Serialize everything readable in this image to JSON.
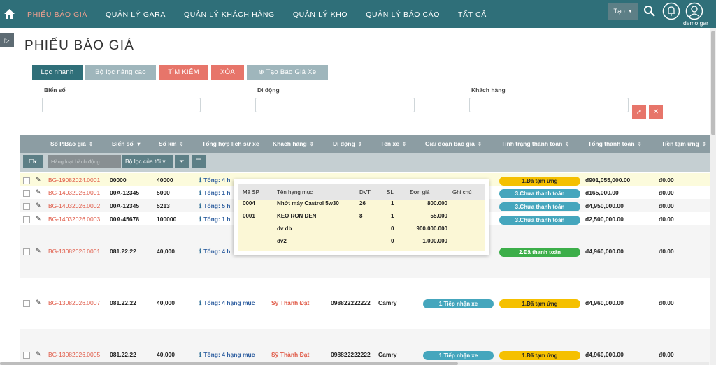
{
  "nav": {
    "items": [
      {
        "label": "PHIẾU BÁO GIÁ",
        "active": true
      },
      {
        "label": "QUẢN LÝ GARA",
        "active": false
      },
      {
        "label": "QUẢN LÝ KHÁCH HÀNG",
        "active": false
      },
      {
        "label": "QUẢN LÝ KHO",
        "active": false
      },
      {
        "label": "QUẢN LÝ BÁO CÁO",
        "active": false
      },
      {
        "label": "TẤT CẢ",
        "active": false
      }
    ],
    "tao_label": "Tạo",
    "user_name": "demo.gar"
  },
  "page_title": "PHIẾU BÁO GIÁ",
  "filter_tabs": {
    "loc_nhanh": "Lọc nhanh",
    "bo_loc_nang_cao": "Bộ lọc nâng cao",
    "tim_kiem": "TÌM KIẾM",
    "xoa": "XÓA",
    "tao_bao_gia": "Tạo Báo Giá Xe"
  },
  "filters": {
    "bien_so": "Biển số",
    "di_dong": "Di động",
    "khach_hang": "Khách hàng"
  },
  "columns": [
    "Số P.Báo giá",
    "Biển số",
    "Số km",
    "Tổng hợp lịch sử xe",
    "Khách hàng",
    "Di động",
    "Tên xe",
    "Giai đoạn báo giá",
    "Tình trạng thanh toán",
    "Tổng thanh toán",
    "Tiền tạm ứng"
  ],
  "toolbar": {
    "bulk_placeholder": "Hàng loạt hành động",
    "my_filter": "Bộ lọc của tôi"
  },
  "rows": [
    {
      "code": "BG-19082024.0001",
      "plate": "00000",
      "km": "40000",
      "history": "Tổng: 4 h",
      "customer": "",
      "phone": "",
      "car": "",
      "stage": "",
      "payment": "1.Đã tạm ứng",
      "payment_color": "yellow",
      "total": "đ901,055,000.00",
      "advance": "đ0.00"
    },
    {
      "code": "BG-14032026.0001",
      "plate": "00A-12345",
      "km": "5000",
      "history": "Tổng: 1 h",
      "customer": "",
      "phone": "",
      "car": "",
      "stage": "",
      "payment": "3.Chưa thanh toán",
      "payment_color": "teal",
      "total": "đ165,000.00",
      "advance": "đ0.00"
    },
    {
      "code": "BG-14032026.0002",
      "plate": "00A-12345",
      "km": "5213",
      "history": "Tổng: 5 h",
      "customer": "",
      "phone": "",
      "car": "",
      "stage": "",
      "payment": "3.Chưa thanh toán",
      "payment_color": "teal",
      "total": "đ4,950,000.00",
      "advance": "đ0.00"
    },
    {
      "code": "BG-14032026.0003",
      "plate": "00A-45678",
      "km": "100000",
      "history": "Tổng: 1 h",
      "customer": "",
      "phone": "",
      "car": "",
      "stage": "",
      "payment": "3.Chưa thanh toán",
      "payment_color": "teal",
      "total": "đ2,500,000.00",
      "advance": "đ0.00"
    },
    {
      "code": "BG-13082026.0001",
      "plate": "081.22.22",
      "km": "40,000",
      "history": "Tổng: 4 h",
      "customer": "",
      "phone": "",
      "car": "",
      "stage": "",
      "payment": "2.Đã thanh toán",
      "payment_color": "green",
      "total": "đ4,960,000.00",
      "advance": "đ0.00"
    },
    {
      "code": "BG-13082026.0007",
      "plate": "081.22.22",
      "km": "40,000",
      "history": "Tổng: 4 hạng mục",
      "customer": "Sỹ Thành Đạt",
      "phone": "098822222222",
      "car": "Camry",
      "stage": "1.Tiếp nhận xe",
      "payment": "1.Đã tạm ứng",
      "payment_color": "yellow",
      "total": "đ4,960,000.00",
      "advance": "đ0.00"
    },
    {
      "code": "BG-13082026.0005",
      "plate": "081.22.22",
      "km": "40,000",
      "history": "Tổng: 4 hạng mục",
      "customer": "Sỹ Thành Đạt",
      "phone": "098822222222",
      "car": "Camry",
      "stage": "1.Tiếp nhận xe",
      "payment": "1.Đã tạm ứng",
      "payment_color": "yellow",
      "total": "đ4,960,000.00",
      "advance": "đ0.00"
    }
  ],
  "popup": {
    "headers": [
      "Mã SP",
      "Tên hạng mục",
      "DVT",
      "SL",
      "Đơn giá",
      "Ghi chú"
    ],
    "items": [
      {
        "ma": "0004",
        "ten": "Nhớt máy Castrol 5w30",
        "dvt": "26",
        "sl": "1",
        "gia": "800.000",
        "ghichu": ""
      },
      {
        "ma": "0001",
        "ten": "KEO RON DEN",
        "dvt": "8",
        "sl": "1",
        "gia": "55.000",
        "ghichu": ""
      },
      {
        "ma": "",
        "ten": "dv db",
        "dvt": "",
        "sl": "0",
        "gia": "900.000.000",
        "ghichu": ""
      },
      {
        "ma": "",
        "ten": "dv2",
        "dvt": "",
        "sl": "0",
        "gia": "1.000.000",
        "ghichu": ""
      }
    ]
  },
  "colors": {
    "nav_bg": "#2f6f79",
    "accent": "#e7756a",
    "active_nav": "#f0a08f"
  }
}
